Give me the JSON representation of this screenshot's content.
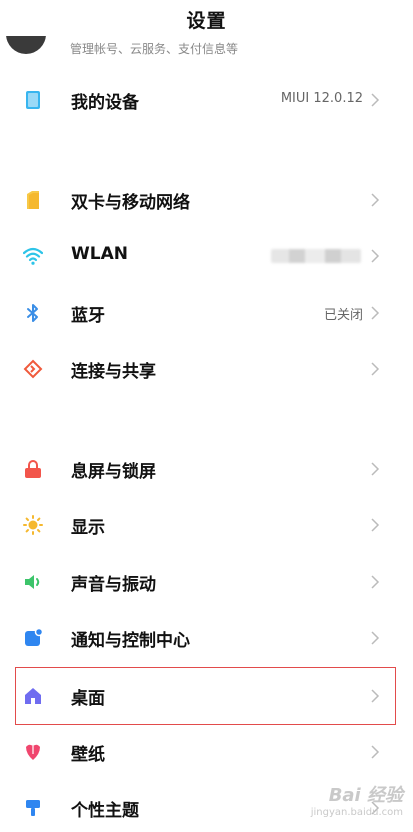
{
  "header": {
    "title": "设置"
  },
  "account": {
    "subtitle": "管理帐号、云服务、支付信息等"
  },
  "device": {
    "label": "我的设备",
    "value": "MIUI 12.0.12"
  },
  "network": [
    {
      "label": "双卡与移动网络",
      "icon": "sim-icon",
      "color": "#f5b82e"
    },
    {
      "label": "WLAN",
      "icon": "wifi-icon",
      "color": "#2ec4e8"
    },
    {
      "label": "蓝牙",
      "icon": "bluetooth-icon",
      "color": "#3a8ee6",
      "value": "已关闭"
    },
    {
      "label": "连接与共享",
      "icon": "share-icon",
      "color": "#f05a3c"
    }
  ],
  "system": [
    {
      "label": "息屏与锁屏",
      "icon": "lock-icon",
      "color": "#f2554b"
    },
    {
      "label": "显示",
      "icon": "sun-icon",
      "color": "#f5b82e"
    },
    {
      "label": "声音与振动",
      "icon": "speaker-icon",
      "color": "#3cc46a"
    },
    {
      "label": "通知与控制中心",
      "icon": "notification-icon",
      "color": "#2f86f0"
    },
    {
      "label": "桌面",
      "icon": "home-icon",
      "color": "#6f6cf0"
    },
    {
      "label": "壁纸",
      "icon": "flower-icon",
      "color": "#f0466e"
    },
    {
      "label": "个性主题",
      "icon": "brush-icon",
      "color": "#2f86f0"
    }
  ],
  "watermark": {
    "logo": "Bai 经验",
    "url": "jingyan.baidu.com"
  }
}
